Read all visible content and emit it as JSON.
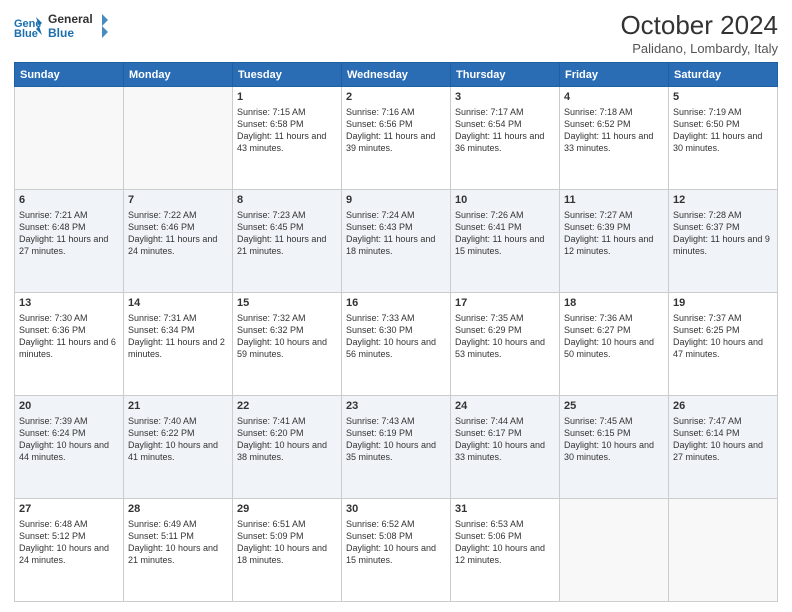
{
  "header": {
    "logo_line1": "General",
    "logo_line2": "Blue",
    "month_title": "October 2024",
    "location": "Palidano, Lombardy, Italy"
  },
  "weekdays": [
    "Sunday",
    "Monday",
    "Tuesday",
    "Wednesday",
    "Thursday",
    "Friday",
    "Saturday"
  ],
  "weeks": [
    [
      {
        "day": "",
        "content": ""
      },
      {
        "day": "",
        "content": ""
      },
      {
        "day": "1",
        "content": "Sunrise: 7:15 AM\nSunset: 6:58 PM\nDaylight: 11 hours and 43 minutes."
      },
      {
        "day": "2",
        "content": "Sunrise: 7:16 AM\nSunset: 6:56 PM\nDaylight: 11 hours and 39 minutes."
      },
      {
        "day": "3",
        "content": "Sunrise: 7:17 AM\nSunset: 6:54 PM\nDaylight: 11 hours and 36 minutes."
      },
      {
        "day": "4",
        "content": "Sunrise: 7:18 AM\nSunset: 6:52 PM\nDaylight: 11 hours and 33 minutes."
      },
      {
        "day": "5",
        "content": "Sunrise: 7:19 AM\nSunset: 6:50 PM\nDaylight: 11 hours and 30 minutes."
      }
    ],
    [
      {
        "day": "6",
        "content": "Sunrise: 7:21 AM\nSunset: 6:48 PM\nDaylight: 11 hours and 27 minutes."
      },
      {
        "day": "7",
        "content": "Sunrise: 7:22 AM\nSunset: 6:46 PM\nDaylight: 11 hours and 24 minutes."
      },
      {
        "day": "8",
        "content": "Sunrise: 7:23 AM\nSunset: 6:45 PM\nDaylight: 11 hours and 21 minutes."
      },
      {
        "day": "9",
        "content": "Sunrise: 7:24 AM\nSunset: 6:43 PM\nDaylight: 11 hours and 18 minutes."
      },
      {
        "day": "10",
        "content": "Sunrise: 7:26 AM\nSunset: 6:41 PM\nDaylight: 11 hours and 15 minutes."
      },
      {
        "day": "11",
        "content": "Sunrise: 7:27 AM\nSunset: 6:39 PM\nDaylight: 11 hours and 12 minutes."
      },
      {
        "day": "12",
        "content": "Sunrise: 7:28 AM\nSunset: 6:37 PM\nDaylight: 11 hours and 9 minutes."
      }
    ],
    [
      {
        "day": "13",
        "content": "Sunrise: 7:30 AM\nSunset: 6:36 PM\nDaylight: 11 hours and 6 minutes."
      },
      {
        "day": "14",
        "content": "Sunrise: 7:31 AM\nSunset: 6:34 PM\nDaylight: 11 hours and 2 minutes."
      },
      {
        "day": "15",
        "content": "Sunrise: 7:32 AM\nSunset: 6:32 PM\nDaylight: 10 hours and 59 minutes."
      },
      {
        "day": "16",
        "content": "Sunrise: 7:33 AM\nSunset: 6:30 PM\nDaylight: 10 hours and 56 minutes."
      },
      {
        "day": "17",
        "content": "Sunrise: 7:35 AM\nSunset: 6:29 PM\nDaylight: 10 hours and 53 minutes."
      },
      {
        "day": "18",
        "content": "Sunrise: 7:36 AM\nSunset: 6:27 PM\nDaylight: 10 hours and 50 minutes."
      },
      {
        "day": "19",
        "content": "Sunrise: 7:37 AM\nSunset: 6:25 PM\nDaylight: 10 hours and 47 minutes."
      }
    ],
    [
      {
        "day": "20",
        "content": "Sunrise: 7:39 AM\nSunset: 6:24 PM\nDaylight: 10 hours and 44 minutes."
      },
      {
        "day": "21",
        "content": "Sunrise: 7:40 AM\nSunset: 6:22 PM\nDaylight: 10 hours and 41 minutes."
      },
      {
        "day": "22",
        "content": "Sunrise: 7:41 AM\nSunset: 6:20 PM\nDaylight: 10 hours and 38 minutes."
      },
      {
        "day": "23",
        "content": "Sunrise: 7:43 AM\nSunset: 6:19 PM\nDaylight: 10 hours and 35 minutes."
      },
      {
        "day": "24",
        "content": "Sunrise: 7:44 AM\nSunset: 6:17 PM\nDaylight: 10 hours and 33 minutes."
      },
      {
        "day": "25",
        "content": "Sunrise: 7:45 AM\nSunset: 6:15 PM\nDaylight: 10 hours and 30 minutes."
      },
      {
        "day": "26",
        "content": "Sunrise: 7:47 AM\nSunset: 6:14 PM\nDaylight: 10 hours and 27 minutes."
      }
    ],
    [
      {
        "day": "27",
        "content": "Sunrise: 6:48 AM\nSunset: 5:12 PM\nDaylight: 10 hours and 24 minutes."
      },
      {
        "day": "28",
        "content": "Sunrise: 6:49 AM\nSunset: 5:11 PM\nDaylight: 10 hours and 21 minutes."
      },
      {
        "day": "29",
        "content": "Sunrise: 6:51 AM\nSunset: 5:09 PM\nDaylight: 10 hours and 18 minutes."
      },
      {
        "day": "30",
        "content": "Sunrise: 6:52 AM\nSunset: 5:08 PM\nDaylight: 10 hours and 15 minutes."
      },
      {
        "day": "31",
        "content": "Sunrise: 6:53 AM\nSunset: 5:06 PM\nDaylight: 10 hours and 12 minutes."
      },
      {
        "day": "",
        "content": ""
      },
      {
        "day": "",
        "content": ""
      }
    ]
  ]
}
